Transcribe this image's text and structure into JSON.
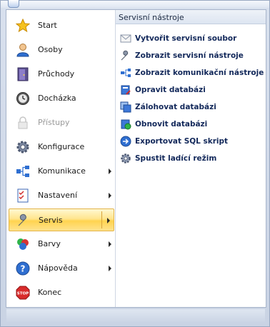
{
  "left_menu": {
    "items": [
      {
        "label": "Start",
        "icon": "star-icon"
      },
      {
        "label": "Osoby",
        "icon": "person-icon"
      },
      {
        "label": "Průchody",
        "icon": "door-icon"
      },
      {
        "label": "Docházka",
        "icon": "clock-icon"
      },
      {
        "label": "Přístupy",
        "icon": "lock-icon",
        "disabled": true
      },
      {
        "label": "Konfigurace",
        "icon": "gear-icon"
      },
      {
        "label": "Komunikace",
        "icon": "network-icon",
        "submenu": true
      },
      {
        "label": "Nastavení",
        "icon": "checklist-icon",
        "submenu": true
      },
      {
        "label": "Servis",
        "icon": "wrench-icon",
        "submenu": true,
        "active": true
      },
      {
        "label": "Barvy",
        "icon": "palette-icon",
        "submenu": true
      },
      {
        "label": "Nápověda",
        "icon": "help-icon",
        "submenu": true
      },
      {
        "label": "Konec",
        "icon": "stop-icon"
      }
    ]
  },
  "submenu": {
    "header": "Servisní nástroje",
    "items": [
      {
        "label": "Vytvořit servisní soubor",
        "icon": "envelope-icon"
      },
      {
        "label": "Zobrazit servisní nástroje",
        "icon": "wrench-icon"
      },
      {
        "label": "Zobrazit komunikační nástroje",
        "icon": "network-icon"
      },
      {
        "label": "Opravit databázi",
        "icon": "database-repair-icon"
      },
      {
        "label": "Zálohovat databázi",
        "icon": "database-backup-icon"
      },
      {
        "label": "Obnovit databázi",
        "icon": "database-restore-icon"
      },
      {
        "label": "Exportovat SQL skript",
        "icon": "export-icon"
      },
      {
        "label": "Spustit ladící režim",
        "icon": "gear-icon"
      }
    ]
  },
  "colors": {
    "accent_active": "#ffd34f",
    "submenu_text": "#12285a"
  }
}
